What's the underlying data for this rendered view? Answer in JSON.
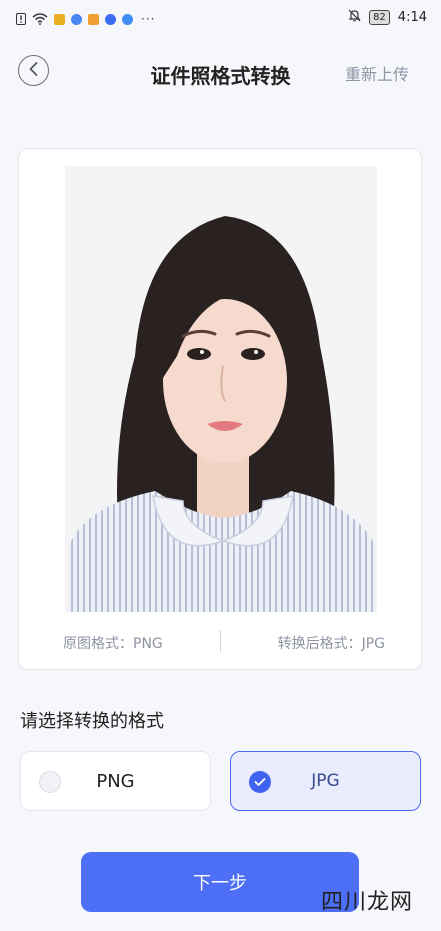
{
  "status_bar": {
    "time": "4:14",
    "battery": "82",
    "more": "···",
    "icons": [
      "alert-icon",
      "wifi-icon",
      "app-icon-1",
      "app-icon-2",
      "app-icon-3",
      "app-icon-4",
      "app-icon-5",
      "mute-icon"
    ],
    "icon_colors": [
      "#e8b021",
      "#4a86f0",
      "#f0a030",
      "#3a6cf2",
      "#3f8ef2"
    ]
  },
  "header": {
    "title": "证件照格式转换",
    "reupload_label": "重新上传"
  },
  "photo_card": {
    "original_format": "原图格式：PNG",
    "converted_format": "转换后格式：JPG"
  },
  "select": {
    "label": "请选择转换的格式",
    "options": [
      {
        "label": "PNG",
        "selected": false
      },
      {
        "label": "JPG",
        "selected": true
      }
    ]
  },
  "next_button": {
    "label": "下一步"
  },
  "watermark": "四川龙网",
  "colors": {
    "accent": "#4d6ff5",
    "selected_bg": "#e8ecfc",
    "muted_text": "#8d93a2"
  }
}
